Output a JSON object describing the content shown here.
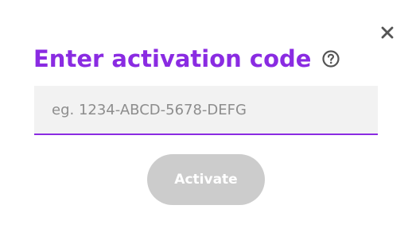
{
  "dialog": {
    "title": "Enter activation code",
    "help_icon": "question-circle-icon",
    "close_icon": "close-icon",
    "input": {
      "value": "",
      "placeholder": "eg. 1234-ABCD-5678-DEFG"
    },
    "activate_label": "Activate",
    "activate_disabled": true
  },
  "colors": {
    "accent": "#8a2be2",
    "input_background": "#f2f2f2",
    "button_disabled": "#cccccc",
    "icon": "#555555"
  }
}
